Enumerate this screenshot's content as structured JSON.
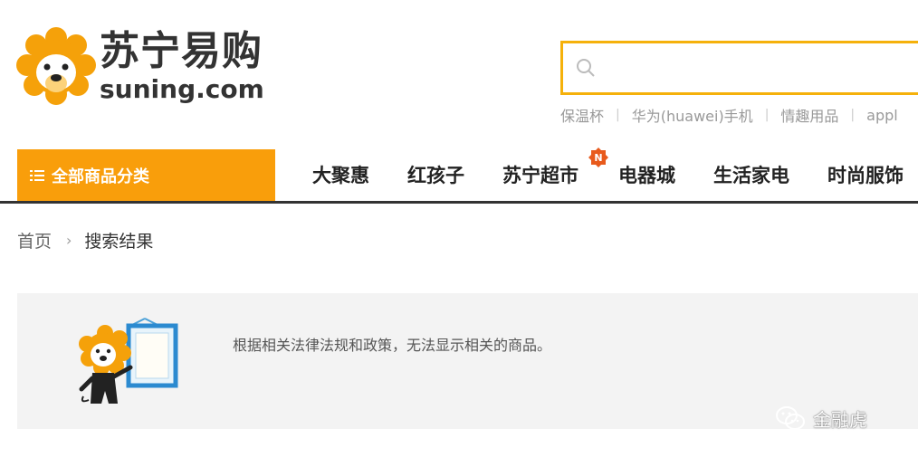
{
  "brand": {
    "name_cn": "苏宁易购",
    "domain": "suning.com",
    "color": "#f99e0b"
  },
  "search": {
    "value": "",
    "icon": "search-icon"
  },
  "hot_words": [
    "保温杯",
    "华为(huawei)手机",
    "情趣用品",
    "appl"
  ],
  "nav": {
    "category_label": "全部商品分类",
    "items": [
      "大聚惠",
      "红孩子",
      "苏宁超市",
      "电器城",
      "生活家电",
      "时尚服饰"
    ],
    "new_badge": "N"
  },
  "breadcrumb": {
    "home": "首页",
    "current": "搜索结果"
  },
  "result": {
    "notice": "根据相关法律法规和政策，无法显示相关的商品。"
  },
  "watermark": {
    "text": "金融虎"
  }
}
